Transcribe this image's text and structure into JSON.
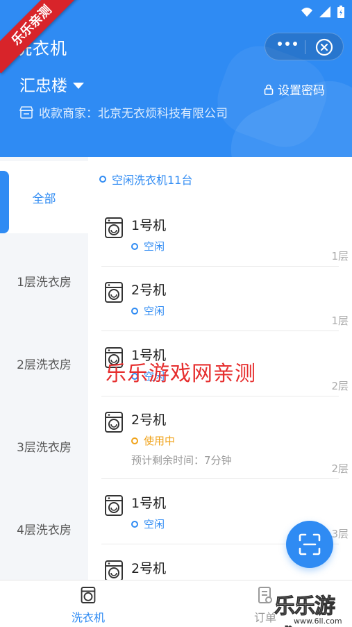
{
  "header": {
    "title": "洗衣机",
    "building": "汇忠楼",
    "set_password": "设置密码",
    "merchant": "收款商家：北京无衣烦科技有限公司"
  },
  "sidebar": {
    "items": [
      {
        "label": "全部",
        "active": true
      },
      {
        "label": "1层洗衣房",
        "active": false
      },
      {
        "label": "2层洗衣房",
        "active": false
      },
      {
        "label": "3层洗衣房",
        "active": false
      },
      {
        "label": "4层洗衣房",
        "active": false
      }
    ]
  },
  "list": {
    "summary": "空闲洗衣机11台",
    "machines": [
      {
        "name": "1号机",
        "status": "空闲",
        "floor": "1层"
      },
      {
        "name": "2号机",
        "status": "空闲",
        "floor": "1层"
      },
      {
        "name": "1号机",
        "status": "空闲",
        "floor": "2层"
      },
      {
        "name": "2号机",
        "status": "使用中",
        "remaining": "预计剩余时间：7分钟",
        "floor": "2层"
      },
      {
        "name": "1号机",
        "status": "空闲",
        "floor": "3层"
      },
      {
        "name": "2号机",
        "status": "",
        "floor": ""
      }
    ]
  },
  "tabbar": {
    "washer": "洗衣机",
    "orders": "订单"
  },
  "watermarks": {
    "ribbon": "乐乐亲测",
    "center": "乐乐游戏网亲测",
    "corner_big": "乐乐游戏",
    "corner_small": "www.6ll.com"
  },
  "colors": {
    "primary": "#2f8bf3",
    "in_use": "#f0a31a",
    "sidebar_bg": "#f4f6f9"
  }
}
